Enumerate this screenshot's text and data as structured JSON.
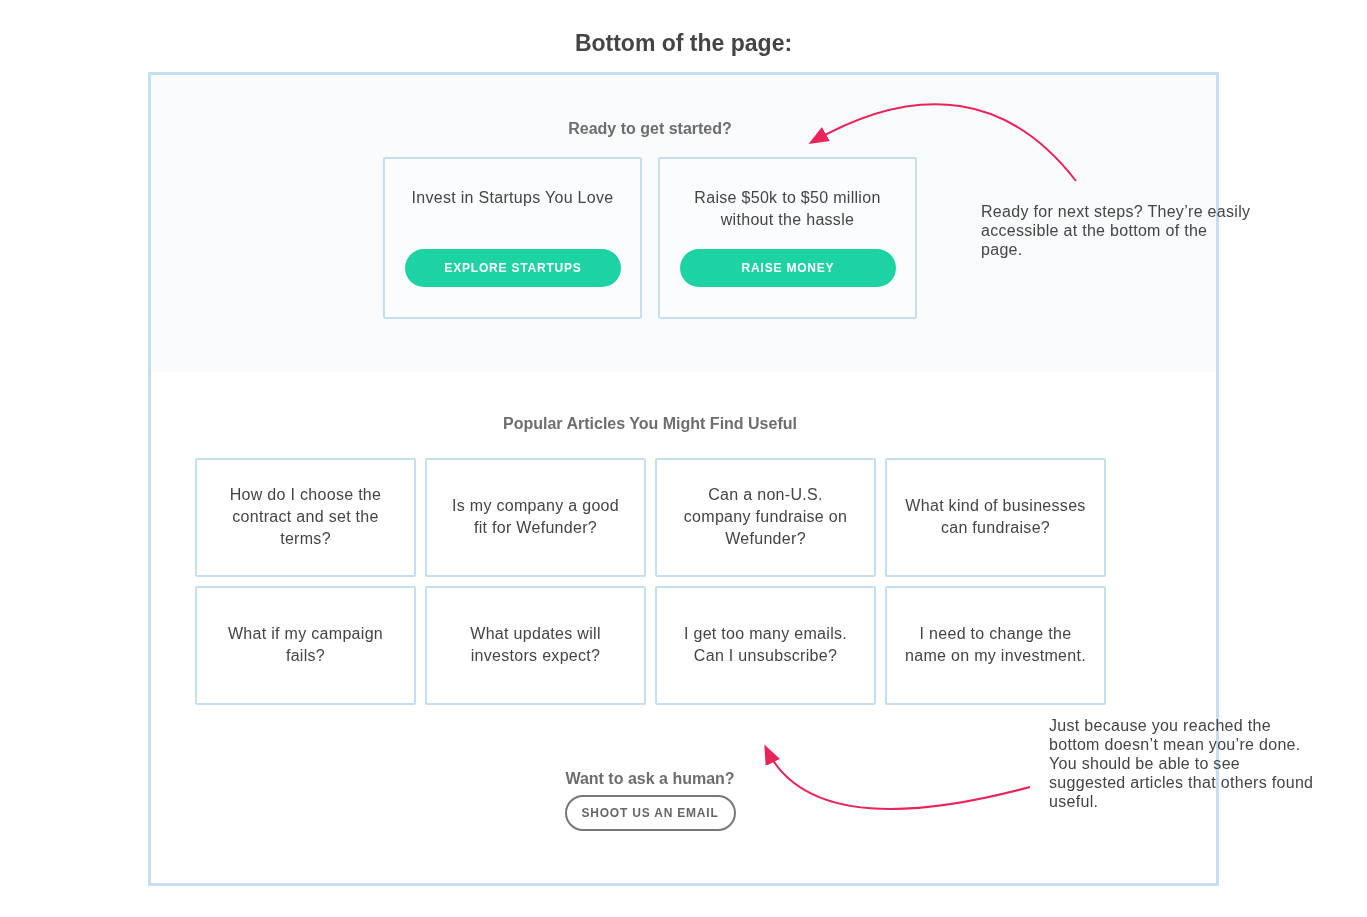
{
  "title": "Bottom of the page:",
  "cta": {
    "heading": "Ready to get started?",
    "cards": [
      {
        "text": "Invest in Startups You Love",
        "button": "EXPLORE STARTUPS"
      },
      {
        "text": "Raise $50k to $50 million without the hassle",
        "button": "RAISE MONEY"
      }
    ]
  },
  "articles": {
    "heading": "Popular Articles You Might Find Useful",
    "items": [
      "How do I choose the contract and set the terms?",
      "Is my company a good fit for Wefunder?",
      "Can a non-U.S. company fundraise on Wefunder?",
      "What kind of businesses can fundraise?",
      "What if my campaign fails?",
      "What updates will investors expect?",
      "I get too many emails. Can I unsubscribe?",
      "I need to change the name on my investment."
    ]
  },
  "contact": {
    "heading": "Want to ask a human?",
    "button": "SHOOT US AN EMAIL"
  },
  "annotations": [
    "Ready for next steps? They’re easily accessible at the bottom of the page.",
    "Just because you reached the bottom doesn’t mean you’re done. You should be able to see suggested articles that others found useful."
  ]
}
